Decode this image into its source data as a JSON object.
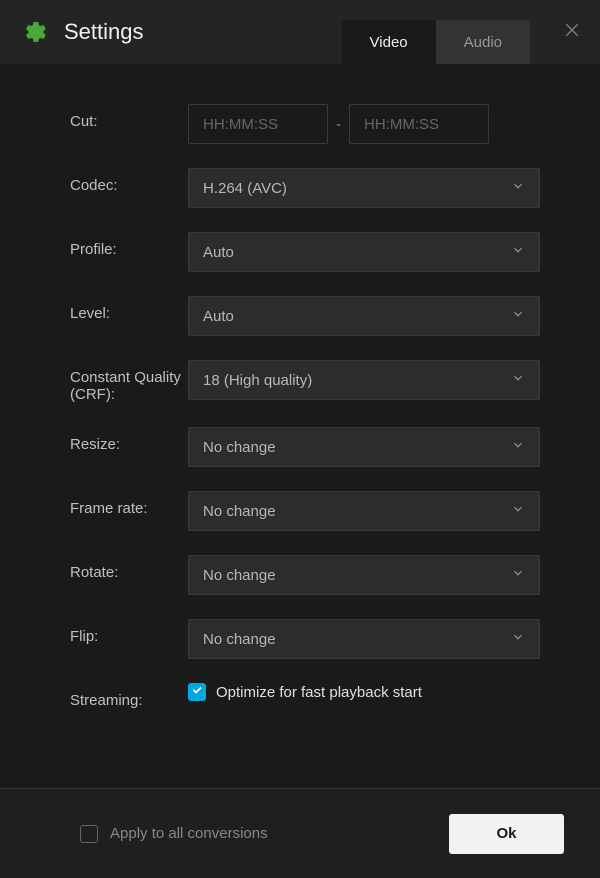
{
  "header": {
    "title": "Settings",
    "tabs": {
      "video": "Video",
      "audio": "Audio"
    }
  },
  "fields": {
    "cut": {
      "label": "Cut:",
      "placeholder_from": "HH:MM:SS",
      "placeholder_to": "HH:MM:SS"
    },
    "codec": {
      "label": "Codec:",
      "value": "H.264 (AVC)"
    },
    "profile": {
      "label": "Profile:",
      "value": "Auto"
    },
    "level": {
      "label": "Level:",
      "value": "Auto"
    },
    "crf": {
      "label": "Constant Quality (CRF):",
      "value": "18 (High quality)"
    },
    "resize": {
      "label": "Resize:",
      "value": "No change"
    },
    "framerate": {
      "label": "Frame rate:",
      "value": "No change"
    },
    "rotate": {
      "label": "Rotate:",
      "value": "No change"
    },
    "flip": {
      "label": "Flip:",
      "value": "No change"
    },
    "streaming": {
      "label": "Streaming:",
      "checkbox_label": "Optimize for fast playback start",
      "checked": true
    }
  },
  "footer": {
    "apply_all": "Apply to all conversions",
    "ok": "Ok"
  }
}
